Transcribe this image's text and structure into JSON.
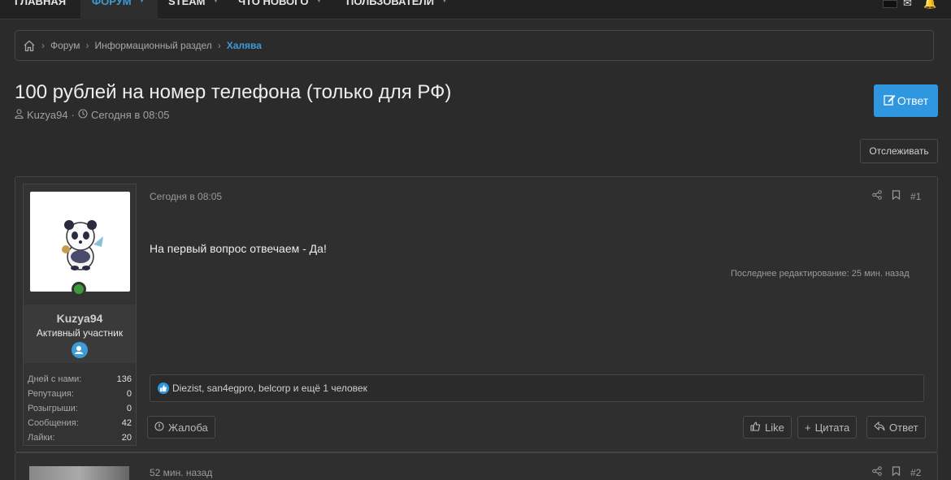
{
  "nav": {
    "items": [
      "Главная",
      "Форум",
      "Steam",
      "Что нового",
      "Пользователи"
    ]
  },
  "breadcrumb": {
    "items": [
      "Форум",
      "Информационный раздел"
    ],
    "current": "Халява"
  },
  "thread": {
    "title": "100 рублей на номер телефона (только для РФ)",
    "author": "Kuzya94",
    "date": "Сегодня в 08:05",
    "reply_label": "Ответ",
    "watch_label": "Отслеживать"
  },
  "post1": {
    "date": "Сегодня в 08:05",
    "number": "#1",
    "body": "На первый вопрос отвечаем - Да!",
    "edit_note": "Последнее редактирование: 25 мин. назад",
    "reactions_text": "Diezist, san4egpro, belcorp и ещё 1 человек",
    "user": {
      "name": "Kuzya94",
      "title": "Активный участник",
      "stats": [
        {
          "label": "Дней с нами:",
          "value": "136"
        },
        {
          "label": "Репутация:",
          "value": "0"
        },
        {
          "label": "Розыгрыши:",
          "value": "0"
        },
        {
          "label": "Сообщения:",
          "value": "42"
        },
        {
          "label": "Лайки:",
          "value": "20"
        }
      ]
    },
    "buttons": {
      "report": "Жалоба",
      "like": "Like",
      "quote": "Цитата",
      "reply": "Ответ"
    }
  },
  "post2": {
    "date": "52 мин. назад",
    "number": "#2"
  },
  "colors": {
    "accent": "#2f97e0",
    "link": "#3d9bd6",
    "background": "#2b2b2b"
  }
}
